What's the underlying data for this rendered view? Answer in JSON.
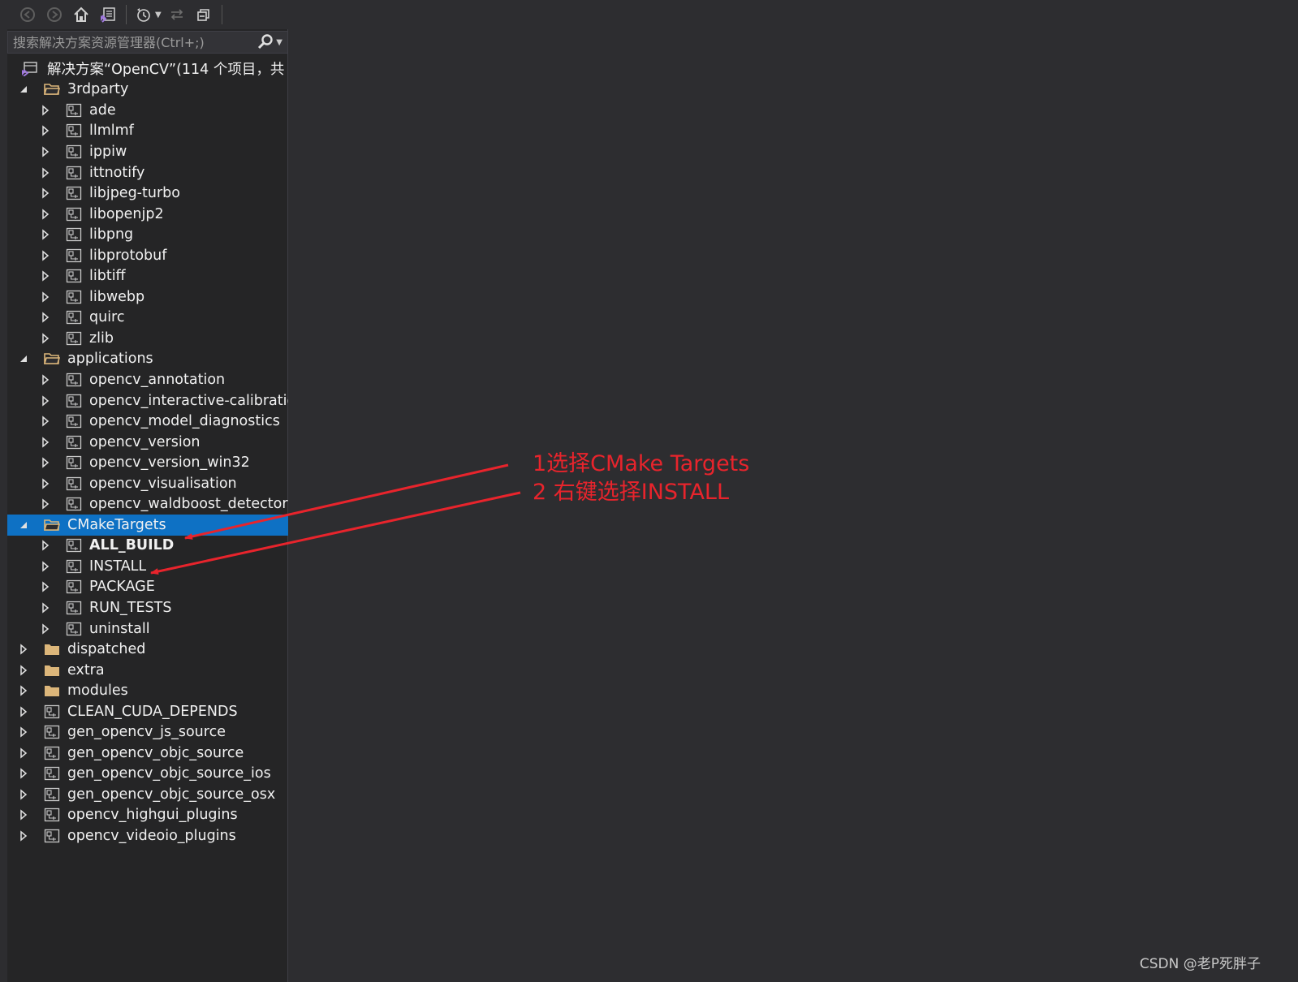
{
  "toolbar": {
    "buttons": [
      {
        "name": "back-icon",
        "glyph": "⊖"
      },
      {
        "name": "forward-icon",
        "glyph": "⊕"
      },
      {
        "name": "home-icon",
        "glyph": "⌂"
      },
      {
        "name": "vs-solution-icon",
        "glyph": "▣"
      },
      {
        "name": "history-icon",
        "glyph": "◷"
      },
      {
        "name": "sync-icon",
        "glyph": "⇆"
      },
      {
        "name": "collapse-all-icon",
        "glyph": "⧉"
      }
    ]
  },
  "search": {
    "placeholder": "搜索解决方案资源管理器(Ctrl+;)"
  },
  "tree": {
    "solution_label": "解决方案“OpenCV”(114 个项目，共",
    "items": [
      {
        "label": "3rdparty",
        "level": 1,
        "kind": "folder-open",
        "expanded": true
      },
      {
        "label": "ade",
        "level": 2,
        "kind": "project"
      },
      {
        "label": "llmlmf",
        "level": 2,
        "kind": "project"
      },
      {
        "label": "ippiw",
        "level": 2,
        "kind": "project"
      },
      {
        "label": "ittnotify",
        "level": 2,
        "kind": "project"
      },
      {
        "label": "libjpeg-turbo",
        "level": 2,
        "kind": "project"
      },
      {
        "label": "libopenjp2",
        "level": 2,
        "kind": "project"
      },
      {
        "label": "libpng",
        "level": 2,
        "kind": "project"
      },
      {
        "label": "libprotobuf",
        "level": 2,
        "kind": "project"
      },
      {
        "label": "libtiff",
        "level": 2,
        "kind": "project"
      },
      {
        "label": "libwebp",
        "level": 2,
        "kind": "project"
      },
      {
        "label": "quirc",
        "level": 2,
        "kind": "project"
      },
      {
        "label": "zlib",
        "level": 2,
        "kind": "project"
      },
      {
        "label": "applications",
        "level": 1,
        "kind": "folder-open",
        "expanded": true
      },
      {
        "label": "opencv_annotation",
        "level": 2,
        "kind": "project"
      },
      {
        "label": "opencv_interactive-calibration",
        "level": 2,
        "kind": "project"
      },
      {
        "label": "opencv_model_diagnostics",
        "level": 2,
        "kind": "project"
      },
      {
        "label": "opencv_version",
        "level": 2,
        "kind": "project"
      },
      {
        "label": "opencv_version_win32",
        "level": 2,
        "kind": "project"
      },
      {
        "label": "opencv_visualisation",
        "level": 2,
        "kind": "project"
      },
      {
        "label": "opencv_waldboost_detector",
        "level": 2,
        "kind": "project"
      },
      {
        "label": "CMakeTargets",
        "level": 1,
        "kind": "folder-open",
        "expanded": true,
        "selected": true
      },
      {
        "label": "ALL_BUILD",
        "level": 2,
        "kind": "project",
        "bold": true
      },
      {
        "label": "INSTALL",
        "level": 2,
        "kind": "project"
      },
      {
        "label": "PACKAGE",
        "level": 2,
        "kind": "project"
      },
      {
        "label": "RUN_TESTS",
        "level": 2,
        "kind": "project"
      },
      {
        "label": "uninstall",
        "level": 2,
        "kind": "project"
      },
      {
        "label": "dispatched",
        "level": 1,
        "kind": "folder"
      },
      {
        "label": "extra",
        "level": 1,
        "kind": "folder"
      },
      {
        "label": "modules",
        "level": 1,
        "kind": "folder"
      },
      {
        "label": "CLEAN_CUDA_DEPENDS",
        "level": 1,
        "kind": "project"
      },
      {
        "label": "gen_opencv_js_source",
        "level": 1,
        "kind": "project"
      },
      {
        "label": "gen_opencv_objc_source",
        "level": 1,
        "kind": "project"
      },
      {
        "label": "gen_opencv_objc_source_ios",
        "level": 1,
        "kind": "project"
      },
      {
        "label": "gen_opencv_objc_source_osx",
        "level": 1,
        "kind": "project"
      },
      {
        "label": "opencv_highgui_plugins",
        "level": 1,
        "kind": "project"
      },
      {
        "label": "opencv_videoio_plugins",
        "level": 1,
        "kind": "project"
      }
    ]
  },
  "annotation": {
    "line1": "1选择CMake Targets",
    "line2": "2 右键选择INSTALL",
    "color": "#e8242c"
  },
  "watermark": "CSDN @老P死胖子",
  "colors": {
    "selection": "#0e71c4",
    "panel_bg": "#252526",
    "editor_bg": "#2d2d30"
  }
}
